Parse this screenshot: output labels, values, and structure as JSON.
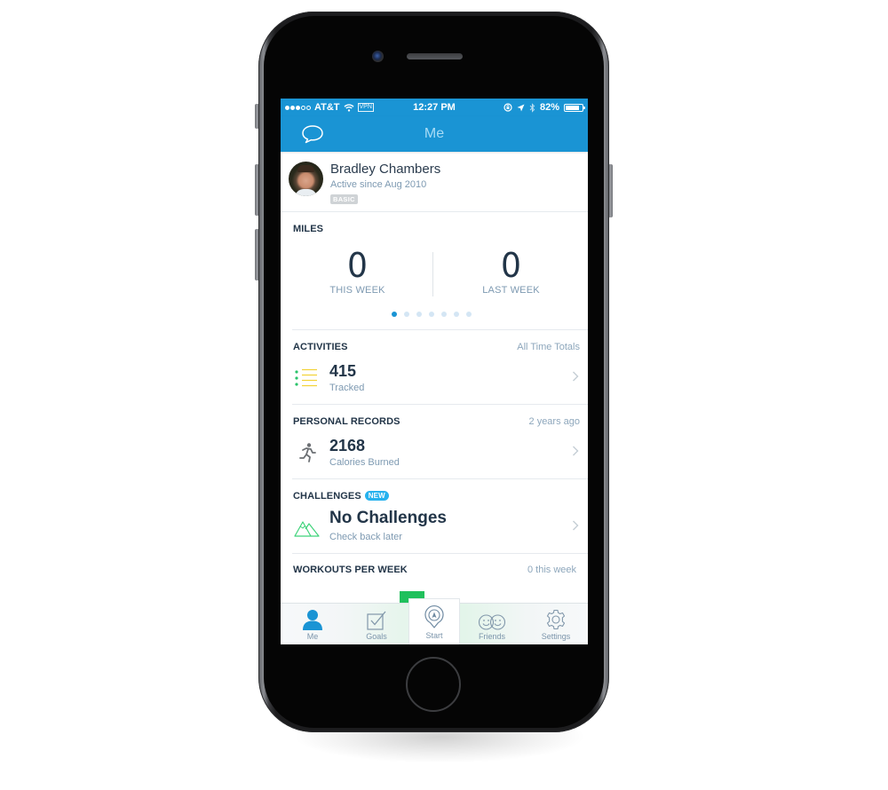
{
  "status_bar": {
    "carrier": "AT&T",
    "signal_bars_filled": 3,
    "signal_bars_total": 5,
    "vpn_label": "VPN",
    "time": "12:27 PM",
    "battery_percent": "82%",
    "battery_level": 0.82,
    "icons": [
      "wifi-icon",
      "rotation-lock-icon",
      "location-icon",
      "bluetooth-icon",
      "battery-icon"
    ]
  },
  "nav": {
    "title": "Me",
    "left_icon": "chat-bubble-icon"
  },
  "profile": {
    "name": "Bradley Chambers",
    "active_since": "Active since Aug 2010",
    "membership_badge": "BASIC"
  },
  "miles": {
    "title": "MILES",
    "columns": [
      {
        "value": "0",
        "label": "THIS WEEK"
      },
      {
        "value": "0",
        "label": "LAST WEEK"
      }
    ],
    "pager": {
      "pages": 7,
      "active_index": 0
    }
  },
  "activities": {
    "title": "ACTIVITIES",
    "right_label": "All Time Totals",
    "value": "415",
    "sub": "Tracked",
    "icon": "list-icon"
  },
  "personal_records": {
    "title": "PERSONAL RECORDS",
    "right_label": "2 years ago",
    "value": "2168",
    "sub": "Calories Burned",
    "icon": "runner-icon"
  },
  "challenges": {
    "title": "CHALLENGES",
    "badge": "NEW",
    "value": "No Challenges",
    "sub": "Check back later",
    "icon": "mountains-icon"
  },
  "workouts": {
    "title": "WORKOUTS PER WEEK",
    "right_label": "0 this week"
  },
  "colors": {
    "brand_blue": "#1a94d4",
    "accent_green": "#20c05c",
    "new_badge": "#27b2ee",
    "text_dark": "#223548",
    "text_muted": "#7e9ab2"
  },
  "tabs": [
    {
      "label": "Me",
      "icon": "person-icon",
      "active": true
    },
    {
      "label": "Goals",
      "icon": "checkbox-icon",
      "active": false
    },
    {
      "label": "Start",
      "icon": "location-pin-icon",
      "active": false
    },
    {
      "label": "Friends",
      "icon": "smiley-faces-icon",
      "active": false
    },
    {
      "label": "Settings",
      "icon": "gear-icon",
      "active": false
    }
  ]
}
